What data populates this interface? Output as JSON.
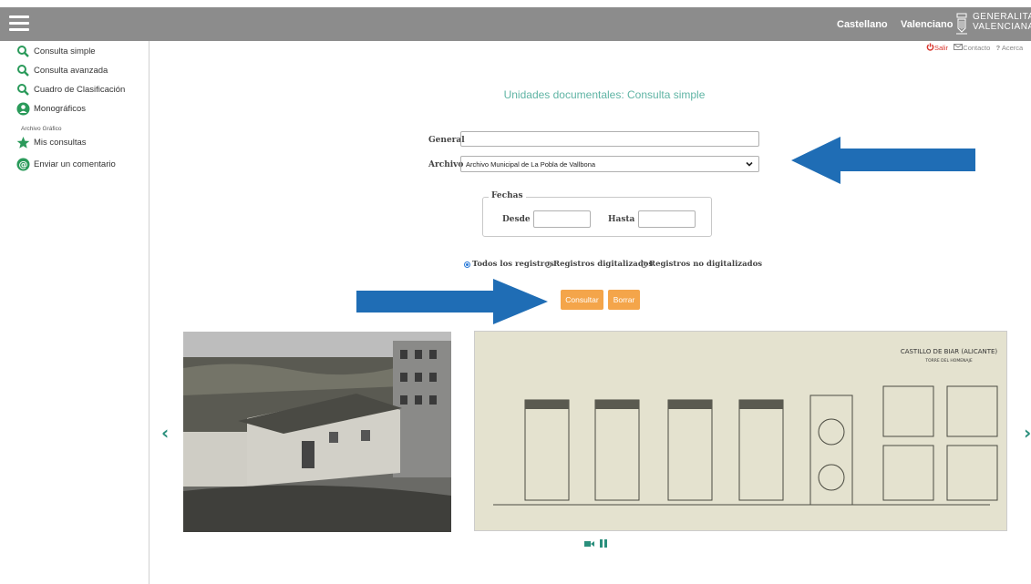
{
  "header": {
    "languages": [
      "Castellano",
      "Valenciano"
    ],
    "logo_text_line1": "GENERALITAT",
    "logo_text_line2": "VALENCIANA",
    "bar_color": "#8c8c8c"
  },
  "utility": {
    "salir": "Salir",
    "contacto": "Contacto",
    "acerca": "Acerca"
  },
  "sidebar": {
    "items": [
      {
        "label": "Consulta simple",
        "icon": "search-icon"
      },
      {
        "label": "Consulta avanzada",
        "icon": "search-icon"
      },
      {
        "label": "Cuadro de Clasificación",
        "icon": "search-icon"
      },
      {
        "label": "Monográficos",
        "icon": "people-icon"
      }
    ],
    "section_label": "Archivo Gráfico",
    "items2": [
      {
        "label": "Mis consultas",
        "icon": "star-icon"
      },
      {
        "label": "Enviar un comentario",
        "icon": "at-icon"
      }
    ]
  },
  "main": {
    "heading": "Unidades documentales: Consulta simple",
    "general_label": "General",
    "general_value": "",
    "archivo_label": "Archivo",
    "archivo_value": "Archivo Municipal de La Pobla de Vallbona",
    "fechas_legend": "Fechas",
    "desde_label": "Desde",
    "hasta_label": "Hasta",
    "radios": [
      {
        "label": "Todos los registros",
        "checked": true
      },
      {
        "label": "Registros digitalizados",
        "checked": false
      },
      {
        "label": "Registros no digitalizados",
        "checked": false
      }
    ],
    "consultar_label": "Consultar",
    "borrar_label": "Borrar"
  },
  "carousel": {
    "drawing_title": "CASTILLO DE BIAR (ALICANTE)",
    "drawing_subtitle": "TORRE DEL HOMENAJE"
  },
  "colors": {
    "accent": "#5fb4a4",
    "button": "#f4a54a",
    "arrow": "#1f6db5"
  }
}
